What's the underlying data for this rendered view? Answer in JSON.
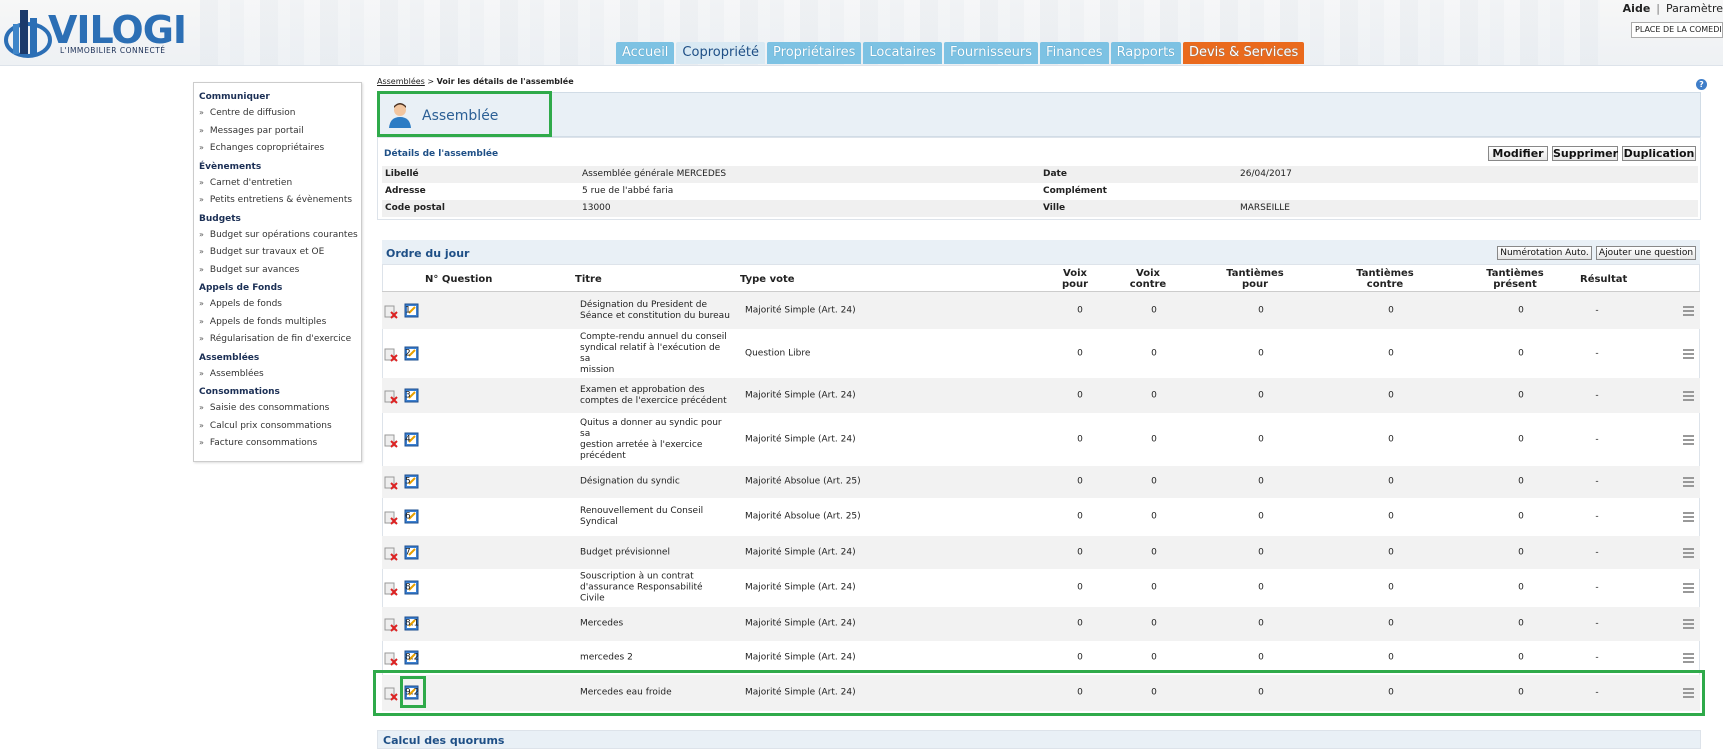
{
  "header": {
    "logo_text": "VILOGI",
    "logo_tagline": "L'IMMOBILIER CONNECTÉ",
    "aide": "Aide",
    "separator": "|",
    "parametres": "Paramètre",
    "building": "PLACE DE LA COMEDIE",
    "nav": [
      "Accueil",
      "Copropriété",
      "Propriétaires",
      "Locataires",
      "Fournisseurs",
      "Finances",
      "Rapports",
      "Devis & Services"
    ],
    "active_tab": "Copropriété",
    "colors": {
      "tab": "#7dc2e3",
      "tab_active": "#d9e9f3",
      "tab_orange": "#ea6a1d"
    }
  },
  "sidebar": {
    "sections": [
      {
        "title": "Communiquer",
        "items": [
          "Centre de diffusion",
          "Messages par portail",
          "Echanges copropriétaires"
        ]
      },
      {
        "title": "Évènements",
        "items": [
          "Carnet d'entretien",
          "Petits entretiens & évènements"
        ]
      },
      {
        "title": "Budgets",
        "items": [
          "Budget sur opérations courantes",
          "Budget sur travaux et OE",
          "Budget sur avances"
        ]
      },
      {
        "title": "Appels de Fonds",
        "items": [
          "Appels de fonds",
          "Appels de fonds multiples",
          "Régularisation de fin d'exercice"
        ]
      },
      {
        "title": "Assemblées",
        "items": [
          "Assemblées"
        ]
      },
      {
        "title": "Consommations",
        "items": [
          "Saisie des consommations",
          "Calcul prix consommations",
          "Facture consommations"
        ]
      }
    ]
  },
  "breadcrumb": {
    "link": "Assemblées",
    "sep": " > ",
    "current": "Voir les détails de l'assemblée"
  },
  "page_title": "Assemblée",
  "details": {
    "title": "Détails de l'assemblée",
    "buttons": {
      "modify": "Modifier",
      "delete": "Supprimer",
      "duplicate": "Duplication"
    },
    "rows": [
      {
        "l1": "Libellé",
        "v1": "Assemblée générale MERCEDES",
        "l2": "Date",
        "v2": "26/04/2017"
      },
      {
        "l1": "Adresse",
        "v1": "5 rue de l'abbé faria",
        "l2": "Complément",
        "v2": ""
      },
      {
        "l1": "Code postal",
        "v1": "13000",
        "l2": "Ville",
        "v2": "MARSEILLE"
      }
    ]
  },
  "ordre": {
    "title": "Ordre du jour",
    "btn_auto": "Numérotation Auto.",
    "btn_add": "Ajouter une question",
    "headers": {
      "num": "N° Question",
      "titre": "Titre",
      "type": "Type vote",
      "voix_pour": [
        "Voix",
        "pour"
      ],
      "voix_contre": [
        "Voix",
        "contre"
      ],
      "tant_pour": [
        "Tantièmes",
        "pour"
      ],
      "tant_contre": [
        "Tantièmes",
        "contre"
      ],
      "tant_present": [
        "Tantièmes",
        "présent"
      ],
      "resultat": "Résultat"
    },
    "rows": [
      {
        "num": "1",
        "titre": [
          "Désignation du President de",
          "Séance et constitution du bureau"
        ],
        "type": "Majorité Simple (Art. 24)",
        "vp": "0",
        "vc": "0",
        "tp": "0",
        "tc": "0",
        "tpr": "0",
        "res": "-"
      },
      {
        "num": "2",
        "titre": [
          "Compte-rendu annuel du conseil",
          "syndical relatif à l'exécution de sa",
          "mission"
        ],
        "type": "Question Libre",
        "vp": "0",
        "vc": "0",
        "tp": "0",
        "tc": "0",
        "tpr": "0",
        "res": "-"
      },
      {
        "num": "3",
        "titre": [
          "Examen et approbation des",
          "comptes de l'exercice précédent"
        ],
        "type": "Majorité Simple (Art. 24)",
        "vp": "0",
        "vc": "0",
        "tp": "0",
        "tc": "0",
        "tpr": "0",
        "res": "-"
      },
      {
        "num": "4",
        "titre": [
          "Quitus a donner au syndic pour sa",
          "gestion arretée à l'exercice",
          "précédent"
        ],
        "type": "Majorité Simple (Art. 24)",
        "vp": "0",
        "vc": "0",
        "tp": "0",
        "tc": "0",
        "tpr": "0",
        "res": "-"
      },
      {
        "num": "5",
        "titre": [
          "Désignation du syndic"
        ],
        "type": "Majorité Absolue (Art. 25)",
        "vp": "0",
        "vc": "0",
        "tp": "0",
        "tc": "0",
        "tpr": "0",
        "res": "-"
      },
      {
        "num": "6",
        "titre": [
          "Renouvellement du Conseil",
          "Syndical"
        ],
        "type": "Majorité Absolue (Art. 25)",
        "vp": "0",
        "vc": "0",
        "tp": "0",
        "tc": "0",
        "tpr": "0",
        "res": "-"
      },
      {
        "num": "7",
        "titre": [
          "Budget prévisionnel"
        ],
        "type": "Majorité Simple (Art. 24)",
        "vp": "0",
        "vc": "0",
        "tp": "0",
        "tc": "0",
        "tpr": "0",
        "res": "-"
      },
      {
        "num": "8",
        "titre": [
          "Souscription à un contrat",
          "d'assurance Responsabilité Civile"
        ],
        "type": "Majorité Simple (Art. 24)",
        "vp": "0",
        "vc": "0",
        "tp": "0",
        "tc": "0",
        "tpr": "0",
        "res": "-"
      },
      {
        "num": "8.1",
        "titre": [
          "Mercedes"
        ],
        "type": "Majorité Simple (Art. 24)",
        "vp": "0",
        "vc": "0",
        "tp": "0",
        "tc": "0",
        "tpr": "0",
        "res": "-"
      },
      {
        "num": "8.2",
        "titre": [
          "mercedes 2"
        ],
        "type": "Majorité Simple (Art. 24)",
        "vp": "0",
        "vc": "0",
        "tp": "0",
        "tc": "0",
        "tpr": "0",
        "res": "-"
      },
      {
        "num": "9.2",
        "titre": [
          "Mercedes eau froide"
        ],
        "type": "Majorité Simple (Art. 24)",
        "vp": "0",
        "vc": "0",
        "tp": "0",
        "tc": "0",
        "tpr": "0",
        "res": "-"
      }
    ]
  },
  "quorum_title": "Calcul des quorums",
  "help_icon": "?"
}
